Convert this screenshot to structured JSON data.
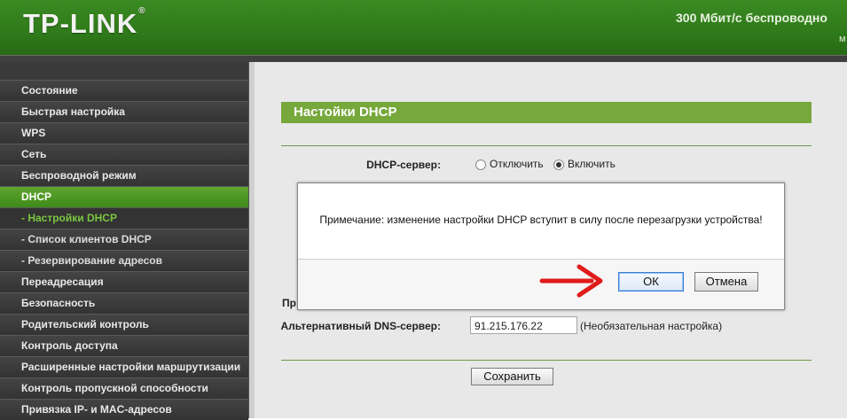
{
  "header": {
    "logo": "TP-LINK",
    "title": "300 Мбит/с беспроводно",
    "model": "м"
  },
  "sidebar": {
    "items": [
      {
        "label": "Состояние"
      },
      {
        "label": "Быстрая настройка"
      },
      {
        "label": "WPS"
      },
      {
        "label": "Сеть"
      },
      {
        "label": "Беспроводной режим"
      },
      {
        "label": "DHCP"
      },
      {
        "label": "- Настройки DHCP"
      },
      {
        "label": "- Список клиентов DHCP"
      },
      {
        "label": "- Резервирование адресов"
      },
      {
        "label": "Переадресация"
      },
      {
        "label": "Безопасность"
      },
      {
        "label": "Родительский контроль"
      },
      {
        "label": "Контроль доступа"
      },
      {
        "label": "Расширенные настройки маршрутизации"
      },
      {
        "label": "Контроль пропускной способности"
      },
      {
        "label": "Привязка IP- и MAC-адресов"
      }
    ]
  },
  "main": {
    "section_title": "Настойки DHCP",
    "dhcp_server_label": "DHCP-сервер:",
    "dhcp_disable": "Отключить",
    "dhcp_enable": "Включить",
    "dhcp_selected": "Включить",
    "partial_label": "Пр",
    "alt_dns_label": "Альтернативный DNS-сервер:",
    "alt_dns_value": "91.215.176.22",
    "alt_dns_hint": "(Необязательная настройка)",
    "save_button": "Сохранить"
  },
  "dialog": {
    "message": "Примечание: изменение настройки DHCP вступит в силу после перезагрузки устройства!",
    "ok": "ОК",
    "cancel": "Отмена"
  },
  "colors": {
    "header_green": "#2f7a1a",
    "section_green": "#76a83b",
    "sidebar_dark": "#3a3a3a",
    "arrow_red": "#e01b1b"
  }
}
